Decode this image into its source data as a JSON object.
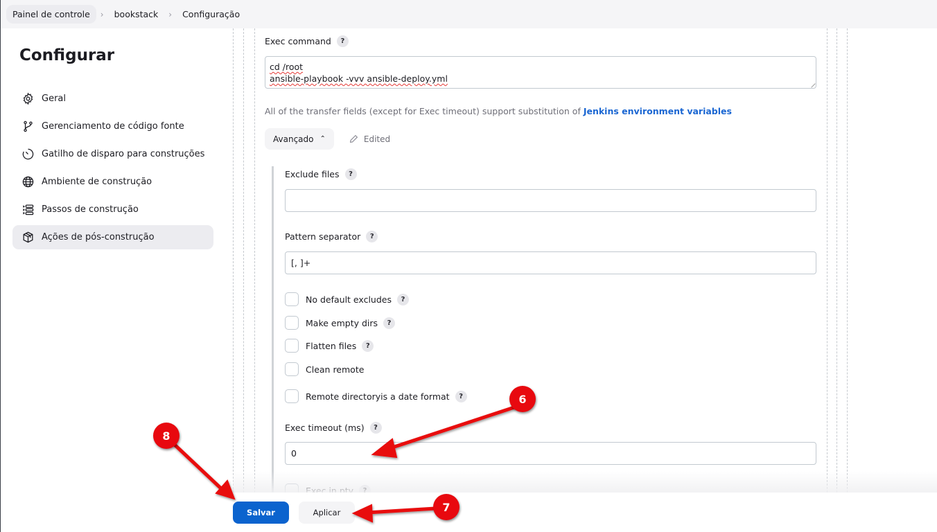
{
  "breadcrumb": [
    "Painel de controle",
    "bookstack",
    "Configuração"
  ],
  "sidebar": {
    "title": "Configurar",
    "items": [
      {
        "label": "Geral",
        "icon": "gear-icon"
      },
      {
        "label": "Gerenciamento de código fonte",
        "icon": "branch-icon"
      },
      {
        "label": "Gatilho de disparo para construções",
        "icon": "timer-icon"
      },
      {
        "label": "Ambiente de construção",
        "icon": "globe-icon"
      },
      {
        "label": "Passos de construção",
        "icon": "list-icon"
      },
      {
        "label": "Ações de pós-construção",
        "icon": "package-icon",
        "active": true
      }
    ]
  },
  "exec_command": {
    "label": "Exec command",
    "help": "?",
    "lines": [
      "cd /root",
      "ansible-playbook -vvv ansible-deploy.yml"
    ]
  },
  "hint": {
    "text": "All of the transfer fields (except for Exec timeout) support substitution of ",
    "link": "Jenkins environment variables"
  },
  "advanced": {
    "button_label": "Avançado",
    "edited_label": "Edited"
  },
  "exclude_files": {
    "label": "Exclude files",
    "help": "?",
    "value": ""
  },
  "pattern_separator": {
    "label": "Pattern separator",
    "help": "?",
    "value": "[, ]+"
  },
  "checkboxes": [
    {
      "label": "No default excludes",
      "help": true,
      "checked": false
    },
    {
      "label": "Make empty dirs",
      "help": true,
      "checked": false
    },
    {
      "label": "Flatten files",
      "help": true,
      "checked": false
    },
    {
      "label": "Clean remote",
      "help": false,
      "checked": false
    },
    {
      "label": "Remote directoryis a date format",
      "help": true,
      "checked": false
    }
  ],
  "exec_timeout": {
    "label": "Exec timeout (ms)",
    "help": "?",
    "value": "0"
  },
  "exec_in_pty": {
    "label": "Exec in pty",
    "help": "?",
    "checked": false
  },
  "buttons": {
    "save": "Salvar",
    "apply": "Aplicar"
  },
  "annotations": [
    {
      "number": "6"
    },
    {
      "number": "7"
    },
    {
      "number": "8"
    }
  ],
  "colors": {
    "primary": "#0b63ce",
    "link": "#1a66d2",
    "annotation": "#e8090f"
  }
}
